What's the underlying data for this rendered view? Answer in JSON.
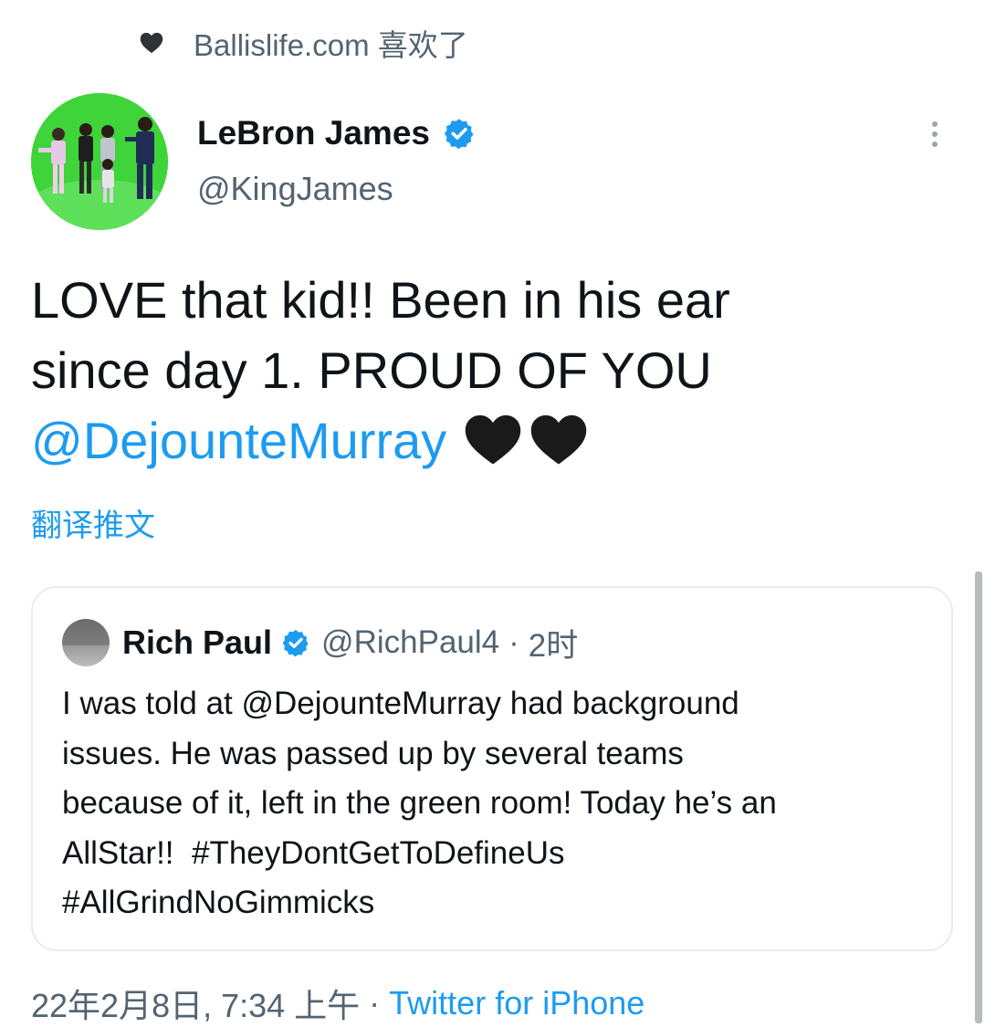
{
  "social_context": {
    "icon": "heart-icon",
    "text": "Ballislife.com 喜欢了"
  },
  "author": {
    "name": "LeBron James",
    "handle": "@KingJames",
    "verified": true,
    "avatar_icon": "profile-photo"
  },
  "tweet": {
    "text_line1": "LOVE that kid!! Been in his ear",
    "text_line2": "since day 1. PROUD OF YOU",
    "mention": "@DejounteMurray",
    "emoji": "black-heart-emoji ×2",
    "translate_label": "翻译推文"
  },
  "quoted_tweet": {
    "name": "Rich Paul",
    "handle": "@RichPaul4",
    "separator": "·",
    "time": "2时",
    "verified": true,
    "lines": [
      "I was told at @DejounteMurray had background",
      "issues. He was passed up by several teams",
      "because of it, left in the green room! Today he’s an",
      "AllStar!!  #TheyDontGetToDefineUs",
      "#AllGrindNoGimmicks"
    ]
  },
  "meta": {
    "date": "22年2月8日, 7:34 上午",
    "separator": "·",
    "source": "Twitter for iPhone"
  },
  "colors": {
    "accent": "#1d9bf0",
    "secondary_text": "#536471",
    "primary_text": "#0f1419"
  }
}
